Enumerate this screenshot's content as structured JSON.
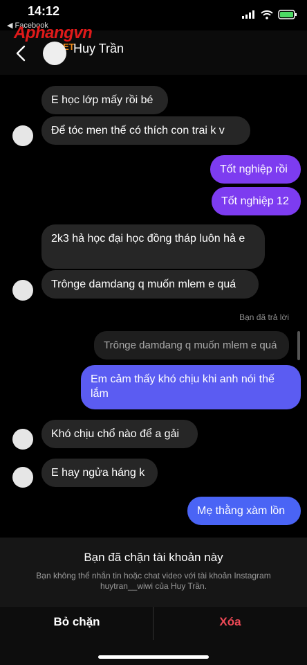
{
  "status": {
    "time": "14:12",
    "back_app": "◀ Facebook"
  },
  "watermark": {
    "brand": "Aphangvn",
    "suffix": ".NET"
  },
  "header": {
    "name": "Huy Trần"
  },
  "messages": {
    "m1": "E học lớp mấy rồi bé",
    "m2": "Để tóc men thế có thích con trai k v",
    "m3": "Tốt nghiệp rồi",
    "m4": "Tốt nghiệp 12",
    "m5": "2k3 hả học đại học đồng tháp luôn hả e",
    "m6": "Trônge damdang q muốn mlem e quá",
    "reply_label": "Bạn đã trả lời",
    "quoted": "Trônge damdang q muốn mlem e quá",
    "m7": "Em cảm thấy khó chịu khi anh nói thế lắm",
    "m8": "Khó chịu chổ nào để a gải",
    "m9": "E hay ngửa háng k",
    "m10": "Mẹ thằng xàm lồn"
  },
  "blocked": {
    "title": "Bạn đã chặn tài khoản này",
    "description": "Bạn không thể nhắn tin hoặc chat video với tài khoản Instagram huytran__wiwi của Huy Trần."
  },
  "actions": {
    "unblock": "Bỏ chặn",
    "delete": "Xóa"
  },
  "colors": {
    "outgoing_purple": "#7d3cf0",
    "outgoing_blue": "#4a64f5",
    "incoming": "#262626",
    "delete_red": "#ed4956"
  }
}
